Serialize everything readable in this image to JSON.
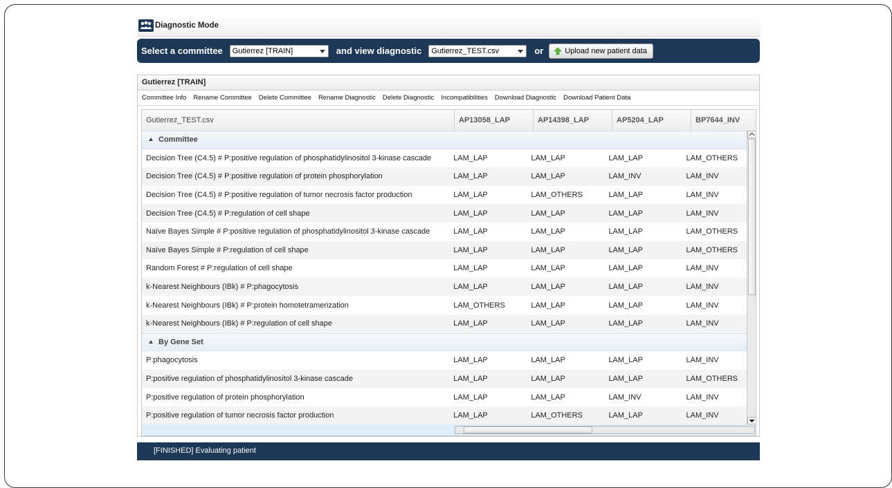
{
  "window": {
    "title": "Diagnostic Mode"
  },
  "toolbar": {
    "select_committee_label": "Select a committee",
    "committee_value": "Gutierrez [TRAIN]",
    "view_diagnostic_label": "and view diagnostic",
    "diagnostic_value": "Gutierrez_TEST.csv",
    "or_label": "or",
    "upload_label": "Upload new patient data"
  },
  "panel": {
    "title": "Gutierrez [TRAIN]",
    "menu": [
      "Committee Info",
      "Rename Committee",
      "Delete Committee",
      "Rename Diagnostic",
      "Delete Diagnostic",
      "Incompatibilities",
      "Download Diagnostic",
      "Download Patient Data"
    ]
  },
  "table": {
    "columns": [
      "Gutierrez_TEST.csv",
      "AP13058_LAP",
      "AP14398_LAP",
      "AP5204_LAP",
      "BP7644_INV"
    ],
    "groups": [
      {
        "label": "Committee",
        "rows": [
          [
            "Decision Tree (C4.5) # P:positive regulation of phosphatidylinositol 3-kinase cascade",
            "LAM_LAP",
            "LAM_LAP",
            "LAM_LAP",
            "LAM_OTHERS"
          ],
          [
            "Decision Tree (C4.5) # P:positive regulation of protein phosphorylation",
            "LAM_LAP",
            "LAM_LAP",
            "LAM_INV",
            "LAM_INV"
          ],
          [
            "Decision Tree (C4.5) # P:positive regulation of tumor necrosis factor production",
            "LAM_LAP",
            "LAM_OTHERS",
            "LAM_LAP",
            "LAM_INV"
          ],
          [
            "Decision Tree (C4.5) # P:regulation of cell shape",
            "LAM_LAP",
            "LAM_LAP",
            "LAM_LAP",
            "LAM_INV"
          ],
          [
            "Naïve Bayes Simple # P:positive regulation of phosphatidylinositol 3-kinase cascade",
            "LAM_LAP",
            "LAM_LAP",
            "LAM_LAP",
            "LAM_OTHERS"
          ],
          [
            "Naïve Bayes Simple # P:regulation of cell shape",
            "LAM_LAP",
            "LAM_LAP",
            "LAM_LAP",
            "LAM_OTHERS"
          ],
          [
            "Random Forest # P:regulation of cell shape",
            "LAM_LAP",
            "LAM_LAP",
            "LAM_LAP",
            "LAM_INV"
          ],
          [
            "k-Nearest Neighbours (IBk) # P:phagocytosis",
            "LAM_LAP",
            "LAM_LAP",
            "LAM_LAP",
            "LAM_INV"
          ],
          [
            "k-Nearest Neighbours (IBk) # P:protein homotetramerization",
            "LAM_OTHERS",
            "LAM_LAP",
            "LAM_LAP",
            "LAM_INV"
          ],
          [
            "k-Nearest Neighbours (IBk) # P:regulation of cell shape",
            "LAM_LAP",
            "LAM_LAP",
            "LAM_LAP",
            "LAM_INV"
          ]
        ]
      },
      {
        "label": "By Gene Set",
        "rows": [
          [
            "P:phagocytosis",
            "LAM_LAP",
            "LAM_LAP",
            "LAM_LAP",
            "LAM_INV"
          ],
          [
            "P:positive regulation of phosphatidylinositol 3-kinase cascade",
            "LAM_LAP",
            "LAM_LAP",
            "LAM_LAP",
            "LAM_OTHERS"
          ],
          [
            "P:positive regulation of protein phosphorylation",
            "LAM_LAP",
            "LAM_LAP",
            "LAM_INV",
            "LAM_INV"
          ],
          [
            "P:positive regulation of tumor necrosis factor production",
            "LAM_LAP",
            "LAM_OTHERS",
            "LAM_LAP",
            "LAM_INV"
          ]
        ]
      }
    ]
  },
  "status": {
    "text": "[FINISHED] Evaluating patient"
  },
  "colors": {
    "bar_bg": "#1d3857",
    "group_bg": "#e6eef7",
    "selection": "#dfeefb"
  },
  "icons": {
    "title": "committee-people-icon",
    "upload": "upload-arrow-icon"
  }
}
